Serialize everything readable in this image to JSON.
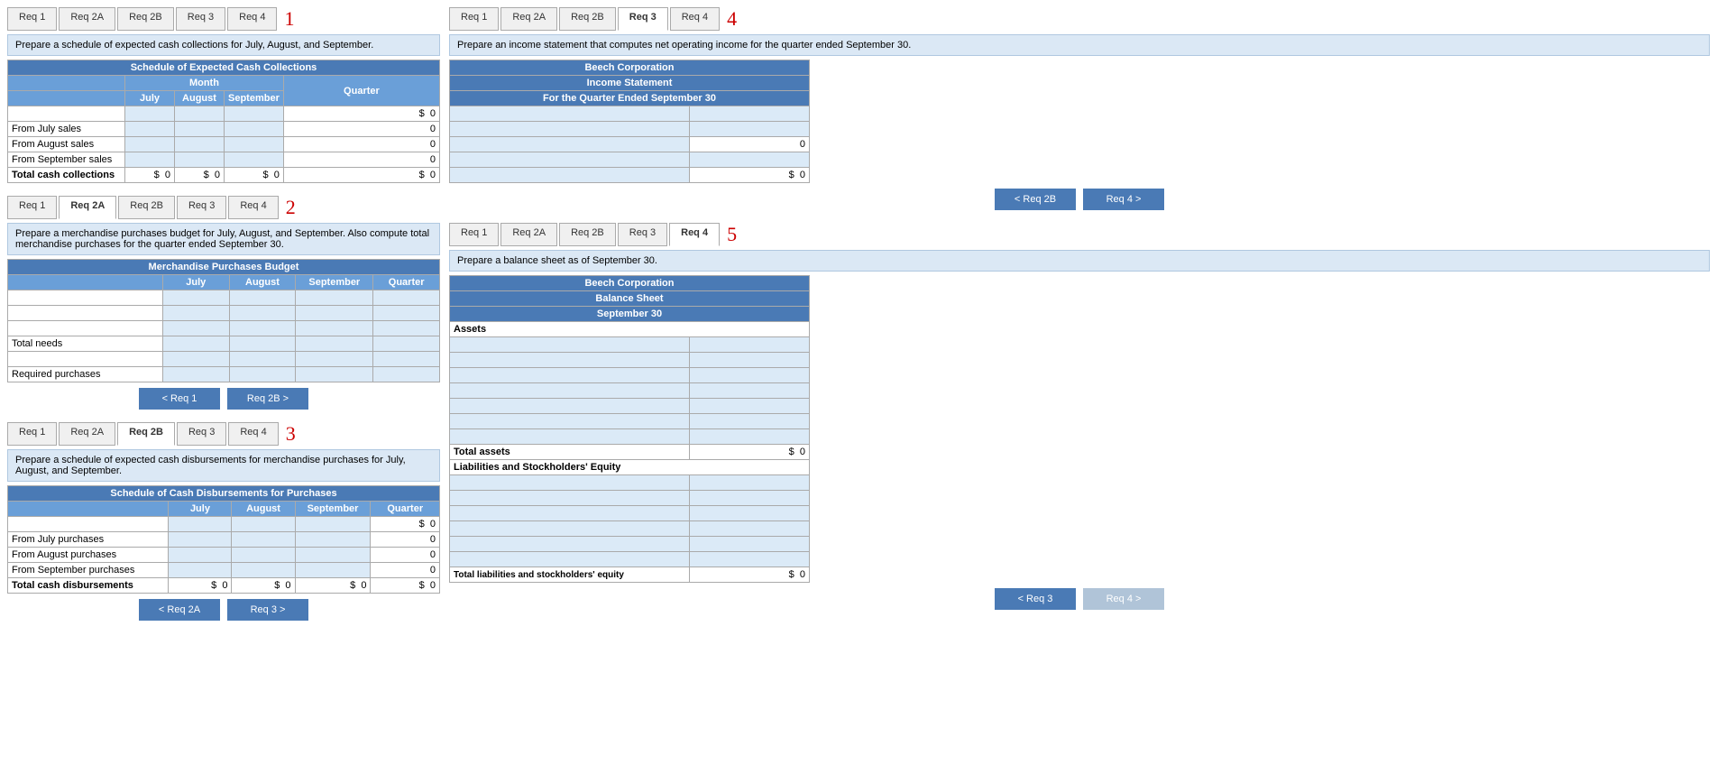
{
  "left": {
    "section1": {
      "tabs": [
        "Req 1",
        "Req 2A",
        "Req 2B",
        "Req 3",
        "Req 4"
      ],
      "active_tab": "Req 1",
      "req_number": "1",
      "instruction": "Prepare a schedule of expected cash collections for July, August, and September.",
      "table_title": "Schedule of Expected Cash Collections",
      "col_header_month": "Month",
      "col_header_quarter": "Quarter",
      "col_july": "July",
      "col_august": "August",
      "col_september": "September",
      "rows": [
        {
          "label": "",
          "july": "",
          "august": "",
          "september": "",
          "quarter": "$  0"
        },
        {
          "label": "From July sales",
          "july": "",
          "august": "",
          "september": "",
          "quarter": "0"
        },
        {
          "label": "From August sales",
          "july": "",
          "august": "",
          "september": "",
          "quarter": "0"
        },
        {
          "label": "From September sales",
          "july": "",
          "august": "",
          "september": "",
          "quarter": "0"
        },
        {
          "label": "Total cash collections",
          "july": "$  0",
          "august": "$  0",
          "september": "$  0",
          "quarter": "$  0"
        }
      ]
    },
    "section2": {
      "tabs": [
        "Req 1",
        "Req 2A",
        "Req 2B",
        "Req 3",
        "Req 4"
      ],
      "active_tab": "Req 2A",
      "req_number": "2",
      "instruction": "Prepare a merchandise purchases budget for July, August, and September. Also compute total merchandise purchases for the quarter ended September 30.",
      "table_title": "Merchandise Purchases Budget",
      "col_july": "July",
      "col_august": "August",
      "col_september": "September",
      "col_quarter": "Quarter",
      "rows": [
        {
          "label": "",
          "july": "",
          "august": "",
          "september": "",
          "quarter": ""
        },
        {
          "label": "",
          "july": "",
          "august": "",
          "september": "",
          "quarter": ""
        },
        {
          "label": "",
          "july": "",
          "august": "",
          "september": "",
          "quarter": ""
        },
        {
          "label": "Total needs",
          "july": "",
          "august": "",
          "september": "",
          "quarter": ""
        },
        {
          "label": "",
          "july": "",
          "august": "",
          "september": "",
          "quarter": ""
        },
        {
          "label": "Required purchases",
          "july": "",
          "august": "",
          "september": "",
          "quarter": ""
        }
      ],
      "btn_prev": "< Req 1",
      "btn_next": "Req 2B >"
    },
    "section3": {
      "tabs": [
        "Req 1",
        "Req 2A",
        "Req 2B",
        "Req 3",
        "Req 4"
      ],
      "active_tab": "Req 2B",
      "req_number": "3",
      "instruction": "Prepare a schedule of expected cash disbursements for merchandise purchases for July, August, and September.",
      "table_title": "Schedule of Cash Disbursements for Purchases",
      "col_july": "July",
      "col_august": "August",
      "col_september": "September",
      "col_quarter": "Quarter",
      "rows": [
        {
          "label": "",
          "july": "",
          "august": "",
          "september": "",
          "quarter": "$  0"
        },
        {
          "label": "From July purchases",
          "july": "",
          "august": "",
          "september": "",
          "quarter": "0"
        },
        {
          "label": "From August purchases",
          "july": "",
          "august": "",
          "september": "",
          "quarter": "0"
        },
        {
          "label": "From September purchases",
          "july": "",
          "august": "",
          "september": "",
          "quarter": "0"
        },
        {
          "label": "Total cash disbursements",
          "july": "$  0",
          "august": "$  0",
          "september": "$  0",
          "quarter": "$  0"
        }
      ],
      "btn_prev": "< Req 2A",
      "btn_next": "Req 3 >"
    }
  },
  "right": {
    "section4": {
      "tabs": [
        "Req 1",
        "Req 2A",
        "Req 2B",
        "Req 3",
        "Req 4"
      ],
      "active_tab": "Req 3",
      "req_number": "4",
      "instruction": "Prepare an income statement that computes net operating income for the quarter ended September 30.",
      "company": "Beech Corporation",
      "statement_title": "Income Statement",
      "period": "For the Quarter Ended September 30",
      "rows": [
        {
          "label": "",
          "value": ""
        },
        {
          "label": "",
          "value": ""
        },
        {
          "label": "",
          "value": "0"
        },
        {
          "label": "",
          "value": ""
        },
        {
          "label": "",
          "value": "$  0"
        }
      ],
      "btn_prev": "< Req 2B",
      "btn_next": "Req 4 >"
    },
    "section5": {
      "tabs": [
        "Req 1",
        "Req 2A",
        "Req 2B",
        "Req 3",
        "Req 4"
      ],
      "active_tab": "Req 4",
      "req_number": "5",
      "instruction": "Prepare a balance sheet as of September 30.",
      "company": "Beech Corporation",
      "statement_title": "Balance Sheet",
      "period": "September 30",
      "assets_label": "Assets",
      "asset_rows": [
        {
          "label": "",
          "value": ""
        },
        {
          "label": "",
          "value": ""
        },
        {
          "label": "",
          "value": ""
        },
        {
          "label": "",
          "value": ""
        },
        {
          "label": "",
          "value": ""
        },
        {
          "label": "",
          "value": ""
        },
        {
          "label": "",
          "value": ""
        }
      ],
      "total_assets_label": "Total assets",
      "total_assets_value": "$  0",
      "liabilities_label": "Liabilities and Stockholders' Equity",
      "liability_rows": [
        {
          "label": "",
          "value": ""
        },
        {
          "label": "",
          "value": ""
        },
        {
          "label": "",
          "value": ""
        },
        {
          "label": "",
          "value": ""
        },
        {
          "label": "",
          "value": ""
        },
        {
          "label": "",
          "value": ""
        }
      ],
      "total_liabilities_label": "Total liabilities and stockholders' equity",
      "total_liabilities_value": "$  0",
      "btn_prev": "< Req 3",
      "btn_next": "Req 4 >"
    }
  }
}
